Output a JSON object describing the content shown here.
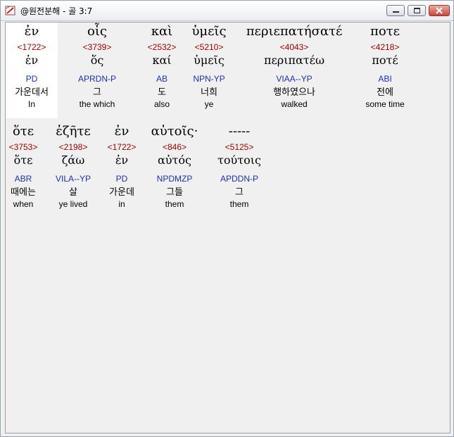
{
  "window": {
    "title": "@원전분해 - 골 3:7"
  },
  "words": [
    {
      "greek": "ἐν",
      "strong": "<1722>",
      "lemma": "ἐν",
      "parse": "PD",
      "korean": "가운데서",
      "english": "In"
    },
    {
      "greek": "οἷς",
      "strong": "<3739>",
      "lemma": "ὅς",
      "parse": "APRDN-P",
      "korean": "그",
      "english": "the which"
    },
    {
      "greek": "καὶ",
      "strong": "<2532>",
      "lemma": "καί",
      "parse": "AB",
      "korean": "도",
      "english": "also"
    },
    {
      "greek": "ὑμεῖς",
      "strong": "<5210>",
      "lemma": "ὑμεῖς",
      "parse": "NPN-YP",
      "korean": "너희",
      "english": "ye"
    },
    {
      "greek": "περιεπατήσατέ",
      "strong": "<4043>",
      "lemma": "περιπατέω",
      "parse": "VIAA--YP",
      "korean": "행하였으나",
      "english": "walked"
    },
    {
      "greek": "ποτε",
      "strong": "<4218>",
      "lemma": "ποτέ",
      "parse": "ABI",
      "korean": "전에",
      "english": "some time"
    },
    {
      "greek": "ὅτε",
      "strong": "<3753>",
      "lemma": "ὅτε",
      "parse": "ABR",
      "korean": "때에는",
      "english": "when"
    },
    {
      "greek": "ἐζῆτε",
      "strong": "<2198>",
      "lemma": "ζάω",
      "parse": "VILA--YP",
      "korean": "살",
      "english": "ye lived"
    },
    {
      "greek": "ἐν",
      "strong": "<1722>",
      "lemma": "ἐν",
      "parse": "PD",
      "korean": "가운데",
      "english": "in"
    },
    {
      "greek": "αὐτοῖς·",
      "strong": "<846>",
      "lemma": "αὐτός",
      "parse": "NPDMZP",
      "korean": "그들",
      "english": "them"
    },
    {
      "greek": "-----",
      "strong": "<5125>",
      "lemma": "τούτοις",
      "parse": "APDDN-P",
      "korean": "그",
      "english": "them"
    }
  ]
}
